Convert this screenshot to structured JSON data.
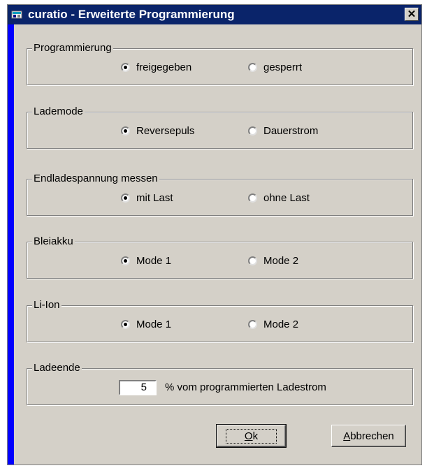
{
  "window": {
    "title": "curatio - Erweiterte Programmierung",
    "close_label": "✕"
  },
  "groups": [
    {
      "label": "Programmierung",
      "options": [
        "freigegeben",
        "gesperrt"
      ],
      "selected": 0
    },
    {
      "label": "Lademode",
      "options": [
        "Reversepuls",
        "Dauerstrom"
      ],
      "selected": 0
    },
    {
      "label": "Endladespannung messen",
      "options": [
        "mit Last",
        "ohne Last"
      ],
      "selected": 0
    },
    {
      "label": "Bleiakku",
      "options": [
        "Mode 1",
        "Mode 2"
      ],
      "selected": 0
    },
    {
      "label": "Li-Ion",
      "options": [
        "Mode 1",
        "Mode 2"
      ],
      "selected": 0
    }
  ],
  "ladeende": {
    "label": "Ladeende",
    "value": "5",
    "suffix": "% vom programmierten Ladestrom"
  },
  "buttons": {
    "ok_accel": "O",
    "ok_rest": "k",
    "cancel_accel": "A",
    "cancel_rest": "bbrechen"
  }
}
